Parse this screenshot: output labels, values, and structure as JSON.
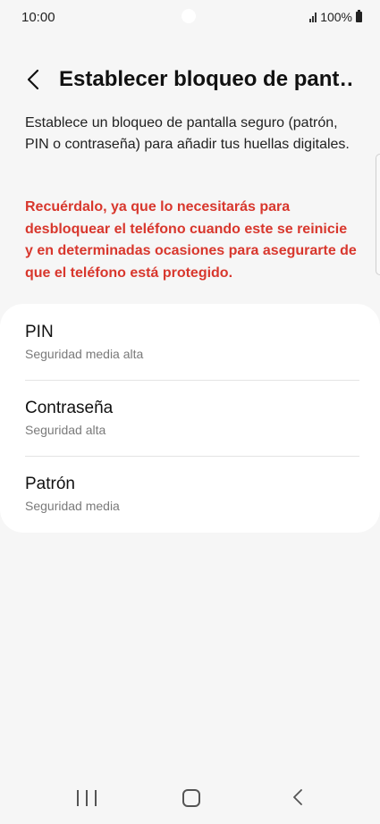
{
  "status_bar": {
    "time": "10:00",
    "battery": "100%"
  },
  "header": {
    "title": "Establecer bloqueo de pant…"
  },
  "description": "Establece un bloqueo de pantalla seguro (patrón, PIN o contraseña) para añadir tus huellas digitales.",
  "warning": "Recuérdalo, ya que lo necesitarás para desbloquear el teléfono cuando este se reinicie y en determinadas ocasiones para asegurarte de que el teléfono está protegido.",
  "options": [
    {
      "title": "PIN",
      "subtitle": "Seguridad media alta"
    },
    {
      "title": "Contraseña",
      "subtitle": "Seguridad alta"
    },
    {
      "title": "Patrón",
      "subtitle": "Seguridad media"
    }
  ],
  "icons": {
    "back": "chevron-left-icon",
    "signal": "signal-icon",
    "battery": "battery-icon",
    "nav_recents": "recents-icon",
    "nav_home": "home-icon",
    "nav_back": "back-icon"
  },
  "colors": {
    "background": "#f6f6f6",
    "card": "#ffffff",
    "warning": "#d8372d",
    "subtitle": "#7a7a7a"
  }
}
